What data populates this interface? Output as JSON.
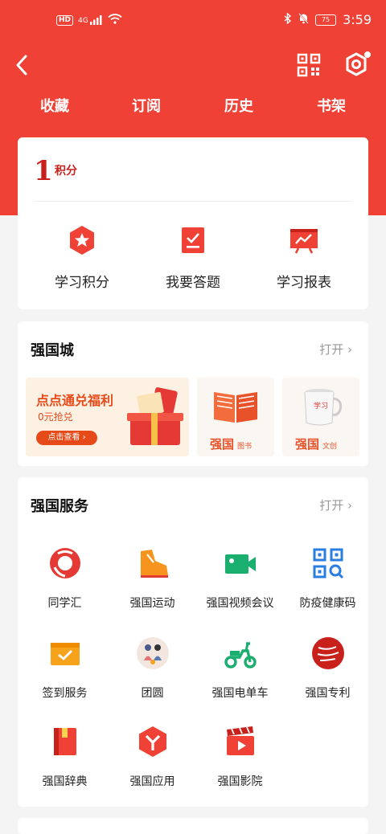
{
  "status_bar": {
    "network_badge": "HD",
    "signal": "4G",
    "battery": "75",
    "time": "3:59"
  },
  "nav": {
    "back_icon": "back-arrow-icon",
    "scan_icon": "qr-code-icon",
    "settings_icon": "settings-hex-icon"
  },
  "tabs": [
    "收藏",
    "订阅",
    "历史",
    "书架"
  ],
  "score": {
    "value": "1",
    "unit": "积分",
    "items": [
      {
        "label": "学习积分",
        "icon": "points-star-icon"
      },
      {
        "label": "我要答题",
        "icon": "quiz-check-icon"
      },
      {
        "label": "学习报表",
        "icon": "report-chart-icon"
      }
    ]
  },
  "mall": {
    "title": "强国城",
    "open_label": "打开",
    "banner": {
      "title": "点点通兑福利",
      "subtitle": "0元抢兑",
      "button": "点击查看 ›"
    },
    "tiles": [
      {
        "brand": "强国",
        "sub": "图书",
        "icon": "book-icon"
      },
      {
        "brand": "强国",
        "sub": "文创",
        "icon": "teacup-icon"
      }
    ]
  },
  "services": {
    "title": "强国服务",
    "open_label": "打开",
    "items": [
      {
        "label": "同学汇",
        "icon": "classmates-icon"
      },
      {
        "label": "强国运动",
        "icon": "sport-shoe-icon"
      },
      {
        "label": "强国视频会议",
        "icon": "video-camera-icon"
      },
      {
        "label": "防疫健康码",
        "icon": "health-qr-icon"
      },
      {
        "label": "签到服务",
        "icon": "checkin-icon"
      },
      {
        "label": "团圆",
        "icon": "reunion-icon"
      },
      {
        "label": "强国电单车",
        "icon": "scooter-icon"
      },
      {
        "label": "强国专利",
        "icon": "patent-icon"
      },
      {
        "label": "强国辞典",
        "icon": "dictionary-icon"
      },
      {
        "label": "强国应用",
        "icon": "apps-icon"
      },
      {
        "label": "强国影院",
        "icon": "cinema-icon"
      }
    ]
  }
}
